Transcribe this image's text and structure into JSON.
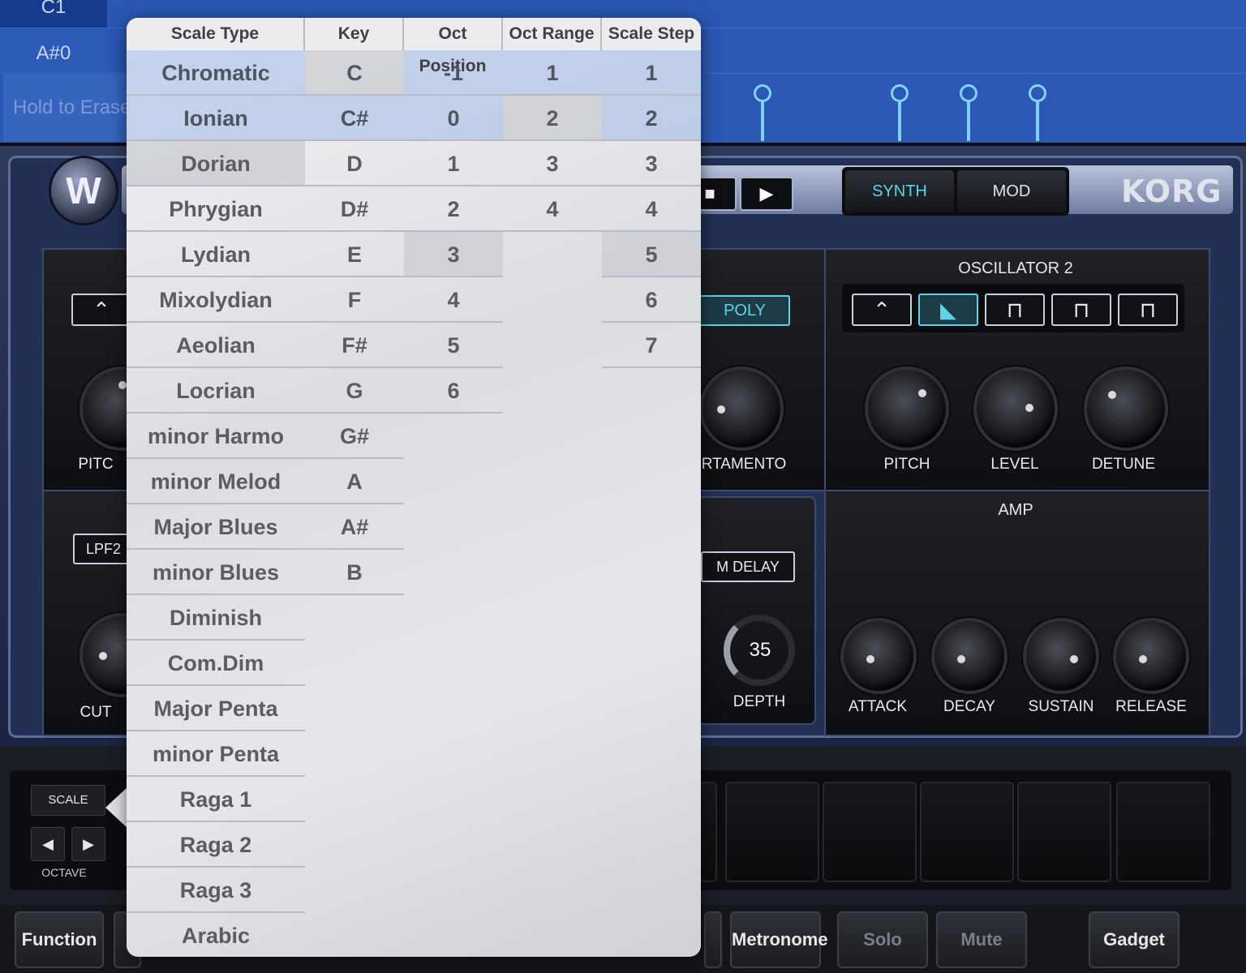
{
  "piano_roll": {
    "keys": [
      "C1",
      "A#0"
    ],
    "hold_to_erase": "Hold to Erase"
  },
  "synth": {
    "brand": "KORG",
    "logo_letter": "W",
    "mode_tabs": [
      "SYNTH",
      "MOD"
    ],
    "active_mode": "SYNTH",
    "oscillator2": {
      "title": "OSCILLATOR 2",
      "waves": [
        "triangle",
        "saw",
        "square",
        "pulse",
        "narrow-pulse"
      ],
      "active_wave": "saw",
      "knobs": [
        "PITCH",
        "LEVEL",
        "DETUNE"
      ]
    },
    "voice_mode": "POLY",
    "portamento_label": "RTAMENTO",
    "osc1_pitch_label": "PITC",
    "filter_type": "LPF2",
    "cutoff_label": "CUT",
    "mod": {
      "delay_button": "M DELAY",
      "depth_value": "35",
      "depth_label": "DEPTH"
    },
    "amp": {
      "title": "AMP",
      "knobs": [
        "ATTACK",
        "DECAY",
        "SUSTAIN",
        "RELEASE"
      ]
    }
  },
  "pads": {
    "scale_button": "SCALE",
    "octave_label": "OCTAVE",
    "octave_down": "◀",
    "octave_up": "▶"
  },
  "toolbar": {
    "function": "Function",
    "metronome": "Metronome",
    "solo": "Solo",
    "mute": "Mute",
    "gadget": "Gadget"
  },
  "scale_popover": {
    "headers": {
      "scale_type": "Scale Type",
      "key": "Key",
      "oct_position": "Oct Position",
      "oct_range": "Oct Range",
      "scale_step": "Scale Step"
    },
    "scale_types": [
      "Chromatic",
      "Ionian",
      "Dorian",
      "Phrygian",
      "Lydian",
      "Mixolydian",
      "Aeolian",
      "Locrian",
      "minor Harmo",
      "minor Melod",
      "Major Blues",
      "minor Blues",
      "Diminish",
      "Com.Dim",
      "Major Penta",
      "minor Penta",
      "Raga 1",
      "Raga 2",
      "Raga 3",
      "Arabic"
    ],
    "keys": [
      "C",
      "C#",
      "D",
      "D#",
      "E",
      "F",
      "F#",
      "G",
      "G#",
      "A",
      "A#",
      "B"
    ],
    "oct_positions": [
      "-1",
      "0",
      "1",
      "2",
      "3",
      "4",
      "5",
      "6"
    ],
    "oct_ranges": [
      "1",
      "2",
      "3",
      "4"
    ],
    "scale_steps": [
      "1",
      "2",
      "3",
      "4",
      "5",
      "6",
      "7"
    ],
    "selected": {
      "scale_type": "Dorian",
      "key": "C",
      "oct_position": "3",
      "oct_range": "2",
      "scale_step": "5"
    }
  },
  "colors": {
    "accent": "#5fd4e6",
    "roll_bg": "#2a58b4",
    "popover_row_highlight": "#a0b9e6"
  }
}
